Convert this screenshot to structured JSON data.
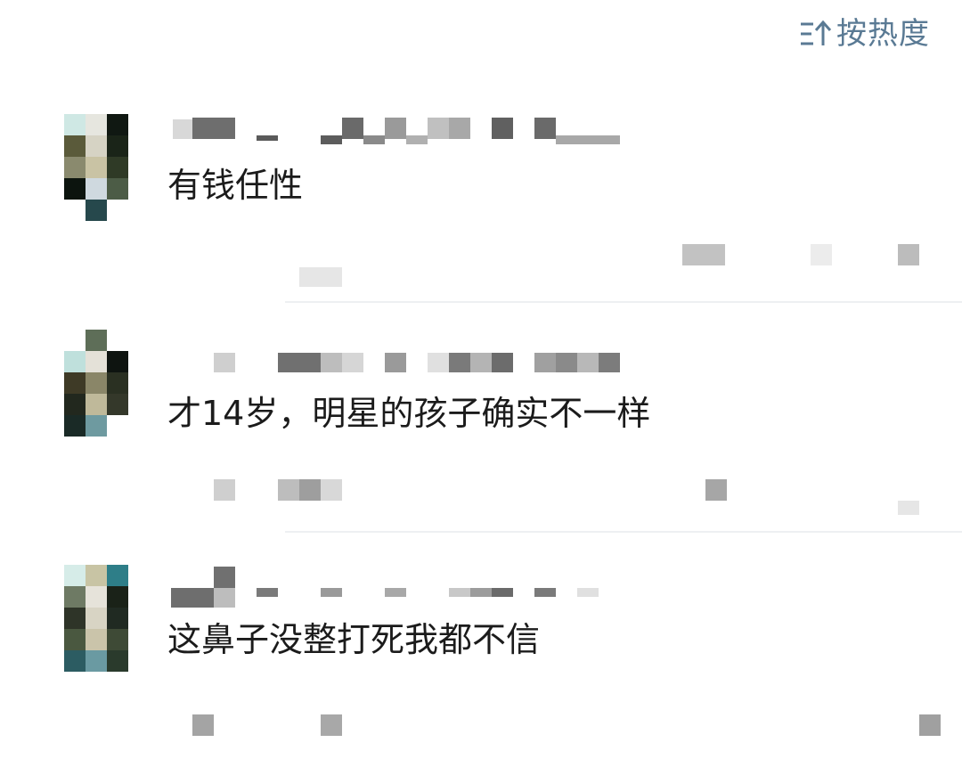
{
  "header": {
    "sort_label": "按热度",
    "sort_icon": "sort-arrow-icon",
    "accent_color": "#5a7a94"
  },
  "comments": [
    {
      "text": "有钱任性"
    },
    {
      "text": "才14岁，明星的孩子确实不一样"
    },
    {
      "text": "这鼻子没整打死我都不信"
    }
  ]
}
